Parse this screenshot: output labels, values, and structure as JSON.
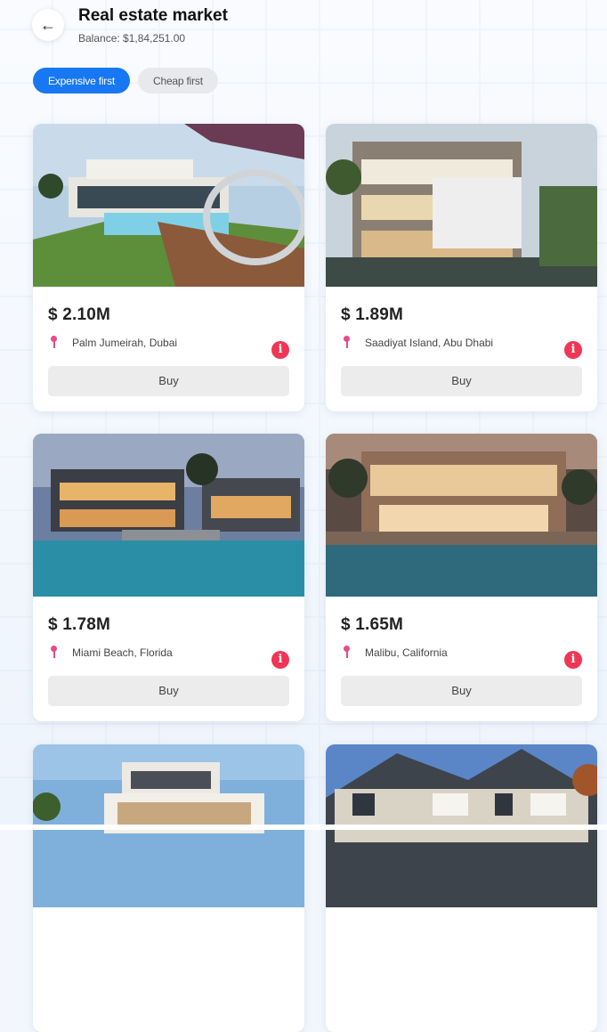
{
  "header": {
    "back_icon": "←",
    "title": "Real estate market",
    "balance": "Balance: $1,84,251.00"
  },
  "sort": {
    "expensive_label": "Expensive first",
    "cheap_label": "Cheap first",
    "active": "expensive"
  },
  "colors": {
    "accent": "#1877f2",
    "info": "#ef3654",
    "pin": "#e84a8a"
  },
  "listings": [
    {
      "price": "$ 2.10M",
      "location": "Palm Jumeirah, Dubai",
      "buy_label": "Buy",
      "info_label": "i"
    },
    {
      "price": "$ 1.89M",
      "location": "Saadiyat Island, Abu Dhabi",
      "buy_label": "Buy",
      "info_label": "i"
    },
    {
      "price": "$ 1.78M",
      "location": "Miami Beach, Florida",
      "buy_label": "Buy",
      "info_label": "i"
    },
    {
      "price": "$ 1.65M",
      "location": "Malibu, California",
      "buy_label": "Buy",
      "info_label": "i"
    },
    {
      "price": "",
      "location": "",
      "buy_label": "",
      "info_label": ""
    },
    {
      "price": "",
      "location": "",
      "buy_label": "",
      "info_label": ""
    }
  ]
}
